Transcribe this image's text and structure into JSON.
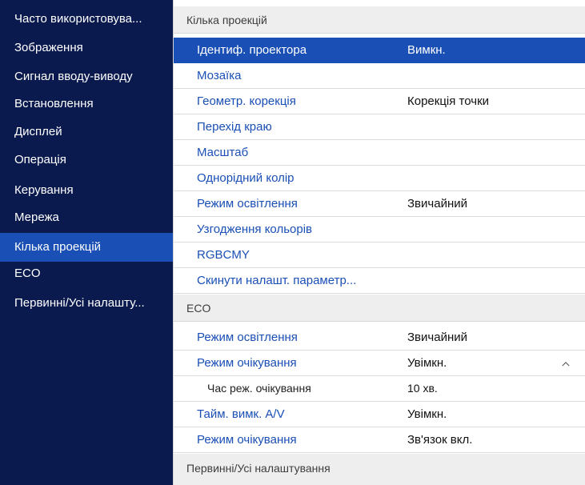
{
  "sidebar": {
    "items": [
      {
        "label": "Часто використовува..."
      },
      {
        "label": "Зображення"
      },
      {
        "label": "Сигнал вводу-виводу"
      },
      {
        "label": "Встановлення"
      },
      {
        "label": "Дисплей"
      },
      {
        "label": "Операція"
      },
      {
        "label": "Керування"
      },
      {
        "label": "Мережа"
      },
      {
        "label": "Кілька проекцій"
      },
      {
        "label": "ECO"
      },
      {
        "label": "Первинні/Усі налашту..."
      }
    ],
    "selected_index": 8
  },
  "main": {
    "multi_projection": {
      "header": "Кілька проекцій",
      "rows": [
        {
          "label": "Ідентиф. проектора",
          "value": "Вимкн."
        },
        {
          "label": "Мозаїка",
          "value": ""
        },
        {
          "label": "Геометр. корекція",
          "value": "Корекція точки"
        },
        {
          "label": "Перехід краю",
          "value": ""
        },
        {
          "label": "Масштаб",
          "value": ""
        },
        {
          "label": "Однорідний колір",
          "value": ""
        },
        {
          "label": "Режим освітлення",
          "value": "Звичайний"
        },
        {
          "label": "Узгодження кольорів",
          "value": ""
        },
        {
          "label": "RGBCMY",
          "value": ""
        },
        {
          "label": "Скинути налашт. параметр...",
          "value": ""
        }
      ],
      "selected_index": 0
    },
    "eco": {
      "header": "ECO",
      "rows": [
        {
          "label": "Режим освітлення",
          "value": "Звичайний"
        },
        {
          "label": "Режим очікування",
          "value": "Увімкн."
        },
        {
          "label": "Час реж. очікування",
          "value": "10 хв."
        },
        {
          "label": "Тайм. вимк. A/V",
          "value": "Увімкн."
        },
        {
          "label": "Режим очікування",
          "value": "Зв'язок вкл."
        }
      ],
      "expand_icon": "chevron-up-icon"
    },
    "initial_settings": {
      "header": "Первинні/Усі налаштування"
    }
  },
  "colors": {
    "sidebar_bg": "#0a1a4e",
    "selection": "#1a4fb5",
    "section_header_bg": "#eeeeee",
    "label_text": "#1a4fb5"
  }
}
